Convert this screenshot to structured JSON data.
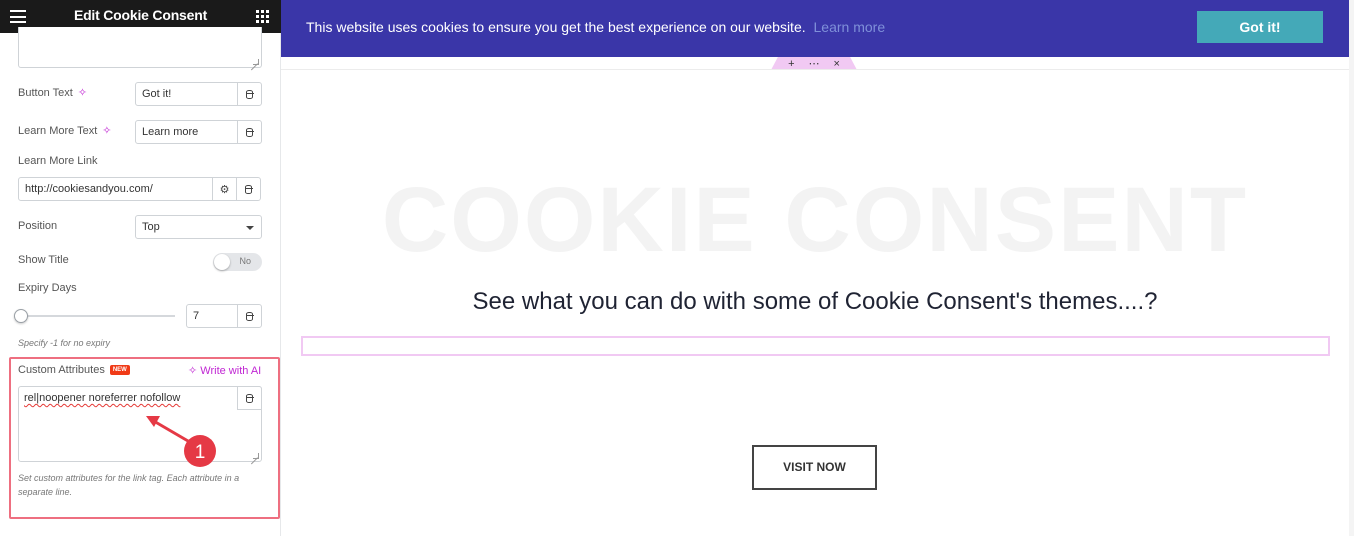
{
  "panel": {
    "title": "Edit Cookie Consent",
    "button_text": {
      "label": "Button Text",
      "value": "Got it!"
    },
    "learn_more_text": {
      "label": "Learn More Text",
      "value": "Learn more"
    },
    "learn_more_link": {
      "label": "Learn More Link",
      "value": "http://cookiesandyou.com/"
    },
    "position": {
      "label": "Position",
      "value": "Top"
    },
    "show_title": {
      "label": "Show Title",
      "value": "No"
    },
    "expiry_days": {
      "label": "Expiry Days",
      "value": "7",
      "hint": "Specify -1 for no expiry"
    },
    "custom_attributes": {
      "label": "Custom Attributes",
      "badge": "NEW",
      "ai_link": "Write with AI",
      "value": "rel|noopener noreferrer nofollow",
      "hint": "Set custom attributes for the link tag. Each attribute in a separate line."
    }
  },
  "annotation": {
    "number": "1",
    "color": "#e53945"
  },
  "preview": {
    "cookie_message": "This website uses cookies to ensure you get the best experience on our website.",
    "learn_more": "Learn more",
    "got_it": "Got it!",
    "handle": {
      "add": "+",
      "more": "⋯",
      "close": "×"
    },
    "bg_title": "COOKIE CONSENT",
    "headline": "See what you can do with some of Cookie Consent's themes....?",
    "visit_button": "VISIT NOW"
  },
  "colors": {
    "cookie_bar": "#3a36a8",
    "got_button": "#44a9b8",
    "ai_accent": "#c026d3",
    "highlight": "#ee6f80"
  }
}
